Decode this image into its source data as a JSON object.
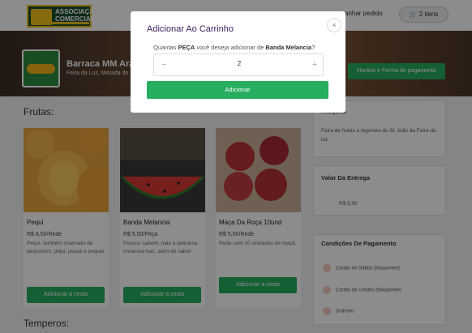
{
  "header": {
    "logo_line1": "ASSOCIAÇÃO",
    "logo_line2": "COMERCIAL",
    "acompanhar": "anhar pedido",
    "cart": "🛒 2 itens"
  },
  "store": {
    "name": "Barraca MM Ara",
    "address": "Feira da Luz, Morada do So",
    "horario": "Horário e Forma de pagamento"
  },
  "main": {
    "section1": "Frutas:",
    "section2": "Temperos:",
    "products": [
      {
        "name": "Pequi",
        "price": "R$ 8,50/Rede",
        "desc": "Pequi, também chamado de pequizeiro, piqui, piquiá e pequiá.",
        "add": "Adicionar a cesta"
      },
      {
        "name": "Banda Melancia",
        "price": "R$ 5,50/Peça",
        "desc": "Poucos sabem, mas a deliciosa melancia traz, além do sabor.",
        "add": "Adicionar a cesta"
      },
      {
        "name": "Maça Da Roça 10und",
        "price": "R$ 5,50/Rede",
        "desc": "Rede com 10 unidades de maçã.",
        "add": "Adicionar a cesta"
      }
    ]
  },
  "side": {
    "p1_title": "rmações",
    "p1_text": "Feira de frutas e legumes do Sr João da Feira da luz",
    "p2_title": "Valor Da Entrega",
    "p2_value": "R$ 5,00",
    "p3_title": "Condições De Pagamento",
    "p3_items": [
      "Cartão de Débito (Maquinete)",
      "Cartão de Crédito (Maquinete)",
      "Dinheiro"
    ]
  },
  "modal": {
    "title": "Adicionar Ao Carrinho",
    "close": "×",
    "q1": "Quantas ",
    "q_unit": "PEÇA",
    "q2": " você deseja adicionar de ",
    "q_product": "Banda Melancia",
    "q3": "?",
    "minus": "−",
    "value": "2",
    "plus": "+",
    "add": "Adicionar"
  }
}
